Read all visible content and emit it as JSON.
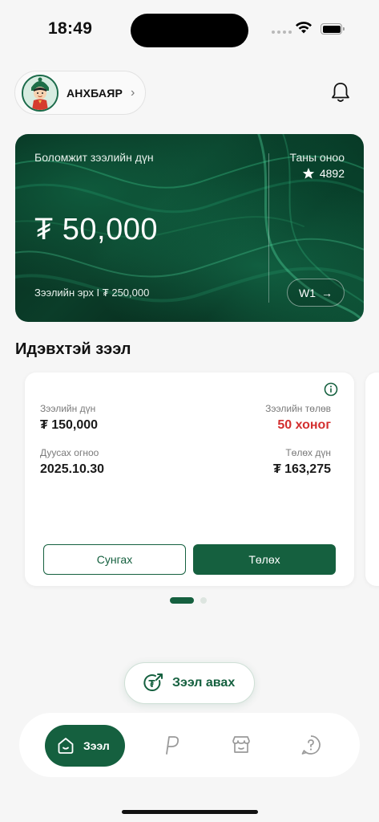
{
  "status": {
    "time": "18:49"
  },
  "profile": {
    "name": "АНХБАЯР",
    "chevron": "›"
  },
  "hero": {
    "label": "Боломжит зээлийн дүн",
    "amount": "₮ 50,000",
    "limit": "Зээлийн эрх I ₮ 250,000",
    "score_label": "Таны оноо",
    "score_value": "4892",
    "tier": "W1",
    "tier_arrow": "→"
  },
  "section": {
    "title": "Идэвхтэй зээл"
  },
  "loan": {
    "amount_label": "Зээлийн дүн",
    "amount_value": "₮ 150,000",
    "term_label": "Зээлийн төлөв",
    "term_value": "50 хоног",
    "due_label": "Дуусах огноо",
    "due_value": "2025.10.30",
    "pay_label": "Төлөх дүн",
    "pay_value": "₮ 163,275",
    "extend_button": "Сунгах",
    "pay_button": "Төлөх"
  },
  "pager": {
    "current": 1,
    "total": 2
  },
  "cta": {
    "label": "Зээл авах"
  },
  "tabbar": {
    "items": [
      {
        "label": "Зээл",
        "icon": "home-icon",
        "active": true
      },
      {
        "label": "",
        "icon": "p-icon",
        "active": false
      },
      {
        "label": "",
        "icon": "store-icon",
        "active": false
      },
      {
        "label": "",
        "icon": "help-icon",
        "active": false
      }
    ]
  },
  "colors": {
    "primary": "#15603f",
    "danger": "#d32f2f",
    "background": "#f6f6f6"
  }
}
